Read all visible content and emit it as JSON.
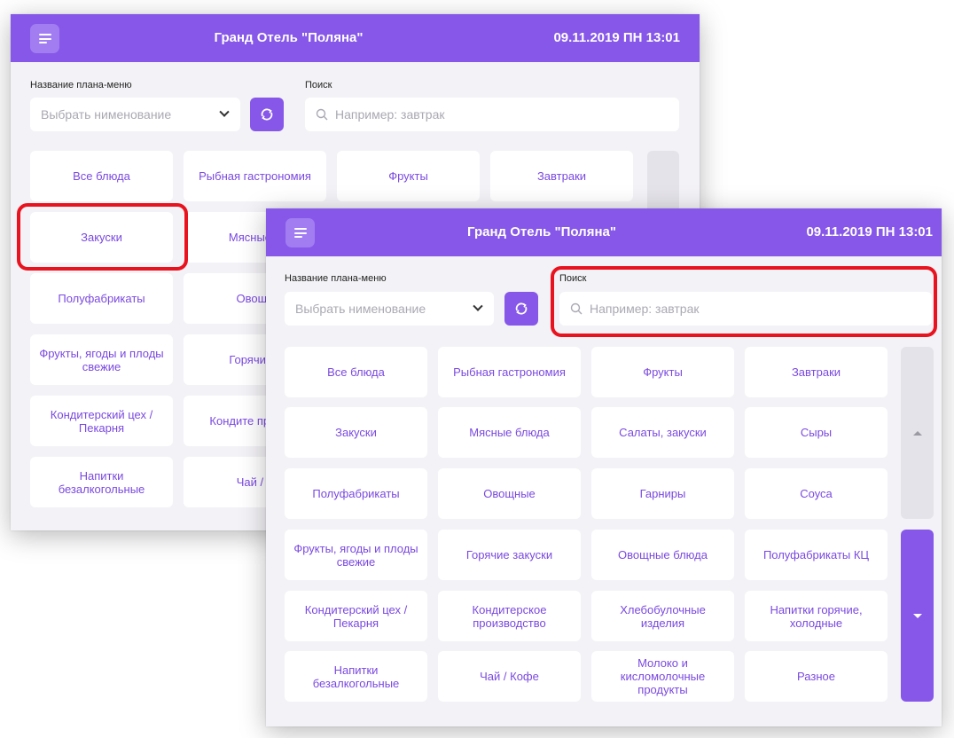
{
  "header": {
    "hotel_title": "Гранд Отель \"Поляна\"",
    "datetime": "09.11.2019 ПН 13:01"
  },
  "filters": {
    "plan_label": "Название плана-меню",
    "plan_placeholder": "Выбрать нименование",
    "search_label": "Поиск",
    "search_placeholder": "Например: завтрак"
  },
  "back_panel": {
    "categories": [
      "Все блюда",
      "Рыбная гастрономия",
      "Фрукты",
      "Завтраки",
      "Закуски",
      "Мясные б",
      "Полуфабрикаты",
      "Овощн",
      "Фрукты, ягоды и плоды свежие",
      "Горячие з",
      "Кондитерский цех / Пекарня",
      "Кондите произво",
      "Напитки безалкогольные",
      "Чай / К"
    ]
  },
  "front_panel": {
    "categories": [
      "Все блюда",
      "Рыбная гастрономия",
      "Фрукты",
      "Завтраки",
      "Закуски",
      "Мясные блюда",
      "Салаты, закуски",
      "Сыры",
      "Полуфабрикаты",
      "Овощные",
      "Гарниры",
      "Соуса",
      "Фрукты, ягоды и плоды свежие",
      "Горячие закуски",
      "Овощные блюда",
      "Полуфабрикаты КЦ",
      "Кондитерский цех / Пекарня",
      "Кондитерское производство",
      "Хлебобулочные изделия",
      "Напитки горячие, холодные",
      "Напитки безалкогольные",
      "Чай / Кофе",
      "Молоко и кисломолочные продукты",
      "Разное"
    ]
  },
  "colors": {
    "accent": "#8657e8",
    "tile_text": "#7a49e0",
    "highlight": "#e8131f",
    "background": "#f3f2f6"
  },
  "icons": [
    "menu-icon",
    "refresh-icon",
    "search-icon",
    "chevron-down-icon",
    "arrow-up-icon",
    "arrow-down-icon"
  ]
}
